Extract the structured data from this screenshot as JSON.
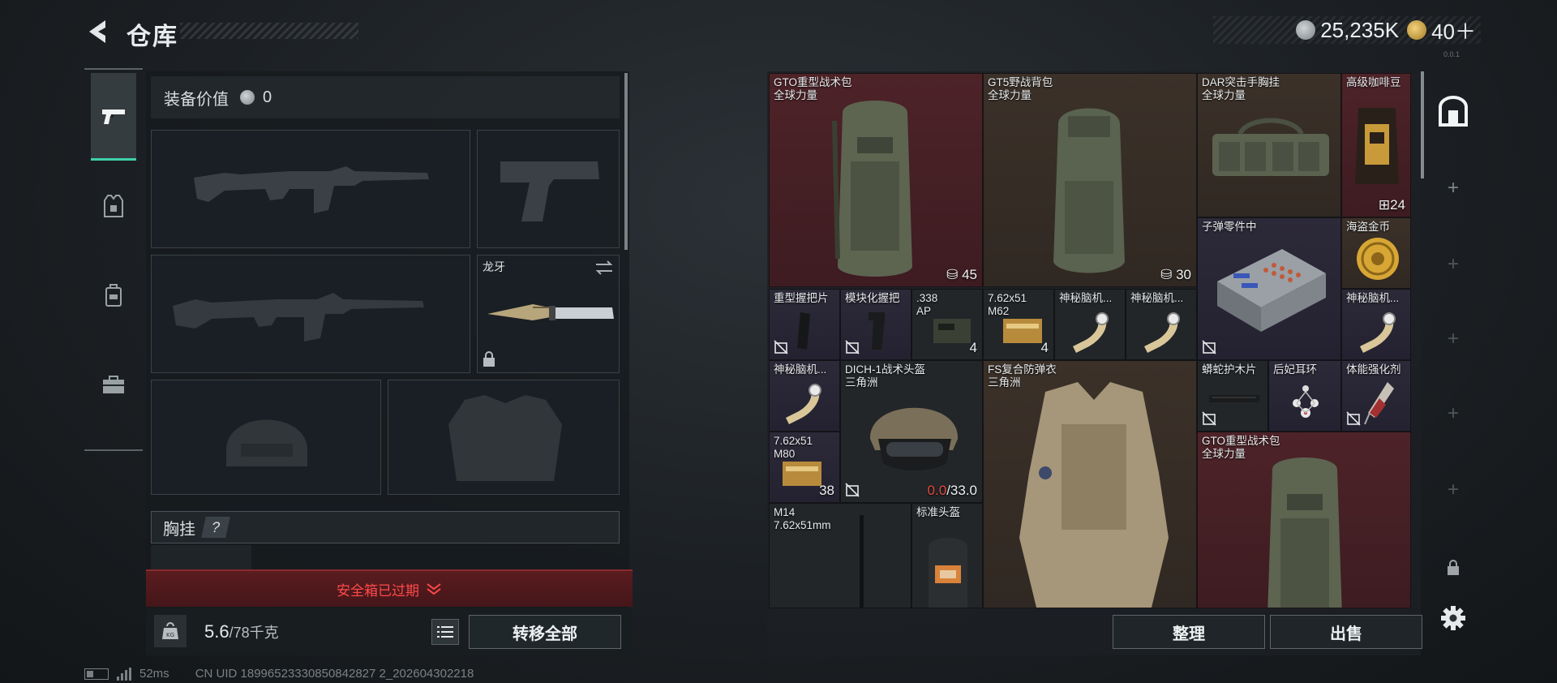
{
  "header": {
    "title": "仓库",
    "silver_amount": "25,235K",
    "gold_amount": "40＋",
    "version_text": "0.0.1"
  },
  "tabs": [
    {
      "icon": "pistol-icon",
      "active": true
    },
    {
      "icon": "armor-rig-icon",
      "active": false
    },
    {
      "icon": "backpack-icon",
      "active": false
    },
    {
      "icon": "toolbox-icon",
      "active": false
    }
  ],
  "equipment": {
    "value_label": "装备价值",
    "value_amount": "0",
    "knife_name": "龙牙",
    "chest_rig_label": "胸挂",
    "chest_rig_help": "?",
    "safebox_status": "安全箱已过期",
    "weight_current": "5.6",
    "weight_capacity": "/78千克",
    "transfer_all": "转移全部"
  },
  "status": {
    "ping": "52ms",
    "uid": "CN UID 18996523330850842827 2_202604302218"
  },
  "stash": {
    "items": [
      {
        "id": "gto-backpack-1",
        "name": "GTO重型战术包",
        "sub": "全球力量",
        "qty": "45",
        "qty_icon": "weight"
      },
      {
        "id": "gt5-backpack",
        "name": "GT5野战背包",
        "sub": "全球力量",
        "qty": "30",
        "qty_icon": "weight"
      },
      {
        "id": "dar-chest-rig",
        "name": "DAR突击手胸挂",
        "sub": "全球力量",
        "qty": "",
        "qty_icon": ""
      },
      {
        "id": "coffee-beans",
        "name": "高级咖啡豆",
        "sub": "",
        "qty": "24",
        "qty_icon": "grid"
      },
      {
        "id": "bullet-parts",
        "name": "子弹零件中",
        "sub": "",
        "qty": "",
        "qty_icon": ""
      },
      {
        "id": "pirate-coin",
        "name": "海盗金币",
        "sub": "",
        "qty": "",
        "qty_icon": ""
      },
      {
        "id": "heavy-grip",
        "name": "重型握把片",
        "sub": "",
        "qty": "",
        "qty_icon": ""
      },
      {
        "id": "modular-grip",
        "name": "模块化握把",
        "sub": "",
        "qty": "",
        "qty_icon": ""
      },
      {
        "id": "ammo-338",
        "name": ".338",
        "sub": "AP",
        "qty": "4",
        "qty_icon": ""
      },
      {
        "id": "ammo-762-m62",
        "name": "7.62x51",
        "sub": "M62",
        "qty": "4",
        "qty_icon": ""
      },
      {
        "id": "brain-1",
        "name": "神秘脑机...",
        "sub": "",
        "qty": "",
        "qty_icon": ""
      },
      {
        "id": "brain-2",
        "name": "神秘脑机...",
        "sub": "",
        "qty": "",
        "qty_icon": ""
      },
      {
        "id": "brain-3",
        "name": "神秘脑机...",
        "sub": "",
        "qty": "",
        "qty_icon": ""
      },
      {
        "id": "brain-4",
        "name": "神秘脑机...",
        "sub": "",
        "qty": "",
        "qty_icon": ""
      },
      {
        "id": "dich-helmet",
        "name": "DICH-1战术头盔",
        "sub": "三角洲",
        "qty_red": "0.0",
        "qty_rest": "/33.0"
      },
      {
        "id": "fs-armor",
        "name": "FS复合防弹衣",
        "sub": "三角洲",
        "qty": "",
        "qty_icon": ""
      },
      {
        "id": "python-handguard",
        "name": "蟒蛇护木片",
        "sub": "",
        "qty": "",
        "qty_icon": ""
      },
      {
        "id": "queen-earring",
        "name": "后妃耳环",
        "sub": "",
        "qty": "",
        "qty_icon": ""
      },
      {
        "id": "stamina-booster",
        "name": "体能强化剂",
        "sub": "",
        "qty": "",
        "qty_icon": ""
      },
      {
        "id": "ammo-762-m80",
        "name": "7.62x51",
        "sub": "M80",
        "qty": "38",
        "qty_icon": ""
      },
      {
        "id": "gto-backpack-2",
        "name": "GTO重型战术包",
        "sub": "全球力量",
        "qty": "",
        "qty_icon": ""
      },
      {
        "id": "m14-rifle",
        "name": "M14",
        "sub": "7.62x51mm",
        "qty": "",
        "qty_icon": ""
      },
      {
        "id": "standard-helmet",
        "name": "标准头盔",
        "sub": "",
        "qty": "",
        "qty_icon": ""
      }
    ],
    "sort_button": "整理",
    "sell_button": "出售"
  },
  "colors": {
    "accent_green": "#3fd1a9",
    "alert_red": "#ff4a4a",
    "rarity_red": "#4d2328",
    "rarity_brown": "#3b3129",
    "rarity_purple": "#2c2938"
  }
}
